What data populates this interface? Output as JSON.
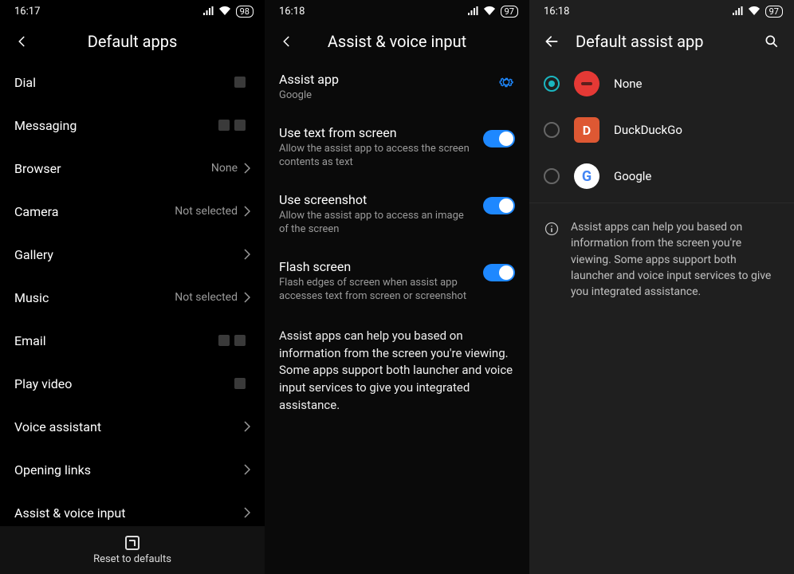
{
  "phone1": {
    "status": {
      "time": "16:17",
      "battery": "98"
    },
    "title": "Default apps",
    "items": [
      {
        "label": "Dial",
        "value": "",
        "chevron": false,
        "blobs": 1
      },
      {
        "label": "Messaging",
        "value": "",
        "chevron": false,
        "blobs": 2
      },
      {
        "label": "Browser",
        "value": "None",
        "chevron": true,
        "blobs": 0
      },
      {
        "label": "Camera",
        "value": "Not selected",
        "chevron": true,
        "blobs": 0
      },
      {
        "label": "Gallery",
        "value": "",
        "chevron": true,
        "blobs": 0
      },
      {
        "label": "Music",
        "value": "Not selected",
        "chevron": true,
        "blobs": 0
      },
      {
        "label": "Email",
        "value": "",
        "chevron": false,
        "blobs": 2
      },
      {
        "label": "Play video",
        "value": "",
        "chevron": false,
        "blobs": 1
      },
      {
        "label": "Voice assistant",
        "value": "",
        "chevron": true,
        "blobs": 0
      },
      {
        "label": "Opening links",
        "value": "",
        "chevron": true,
        "blobs": 0
      },
      {
        "label": "Assist & voice input",
        "value": "",
        "chevron": true,
        "blobs": 0
      }
    ],
    "footer": "Reset to defaults"
  },
  "phone2": {
    "status": {
      "time": "16:18",
      "battery": "97"
    },
    "title": "Assist & voice input",
    "settings": [
      {
        "title": "Assist app",
        "sub": "Google",
        "control": "gear"
      },
      {
        "title": "Use text from screen",
        "sub": "Allow the assist app to access the screen contents as text",
        "control": "toggle"
      },
      {
        "title": "Use screenshot",
        "sub": "Allow the assist app to access an image of the screen",
        "control": "toggle"
      },
      {
        "title": "Flash screen",
        "sub": "Flash edges of screen when assist app accesses text from screen or screenshot",
        "control": "toggle"
      }
    ],
    "info": "Assist apps can help you based on information from the screen you're viewing. Some apps support both launcher and voice input services to give you integrated assistance."
  },
  "phone3": {
    "status": {
      "time": "16:18",
      "battery": "97"
    },
    "title": "Default assist app",
    "options": [
      {
        "name": "None",
        "icon": "none",
        "selected": true
      },
      {
        "name": "DuckDuckGo",
        "icon": "ddg",
        "selected": false
      },
      {
        "name": "Google",
        "icon": "google",
        "selected": false
      }
    ],
    "info": "Assist apps can help you based on information from the screen you're viewing. Some apps support both launcher and voice input services to give you integrated assistance."
  }
}
